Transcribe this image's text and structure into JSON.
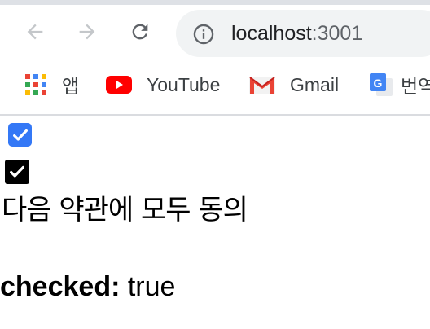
{
  "browser": {
    "url_host": "localhost",
    "url_port": ":3001"
  },
  "bookmarks": [
    {
      "label": "앱",
      "icon": "apps-grid-icon"
    },
    {
      "label": "YouTube",
      "icon": "youtube-icon"
    },
    {
      "label": "Gmail",
      "icon": "gmail-icon"
    },
    {
      "label": "번역",
      "icon": "google-translate-icon"
    }
  ],
  "form": {
    "checkbox_checked": true,
    "agree_label": "다음 약관에 모두 동의",
    "status_label": "checked:",
    "status_value": "true"
  },
  "colors": {
    "checkbox_blue": "#3478f6",
    "youtube_red": "#ff0000",
    "omnibox_bg": "#f1f3f4"
  }
}
